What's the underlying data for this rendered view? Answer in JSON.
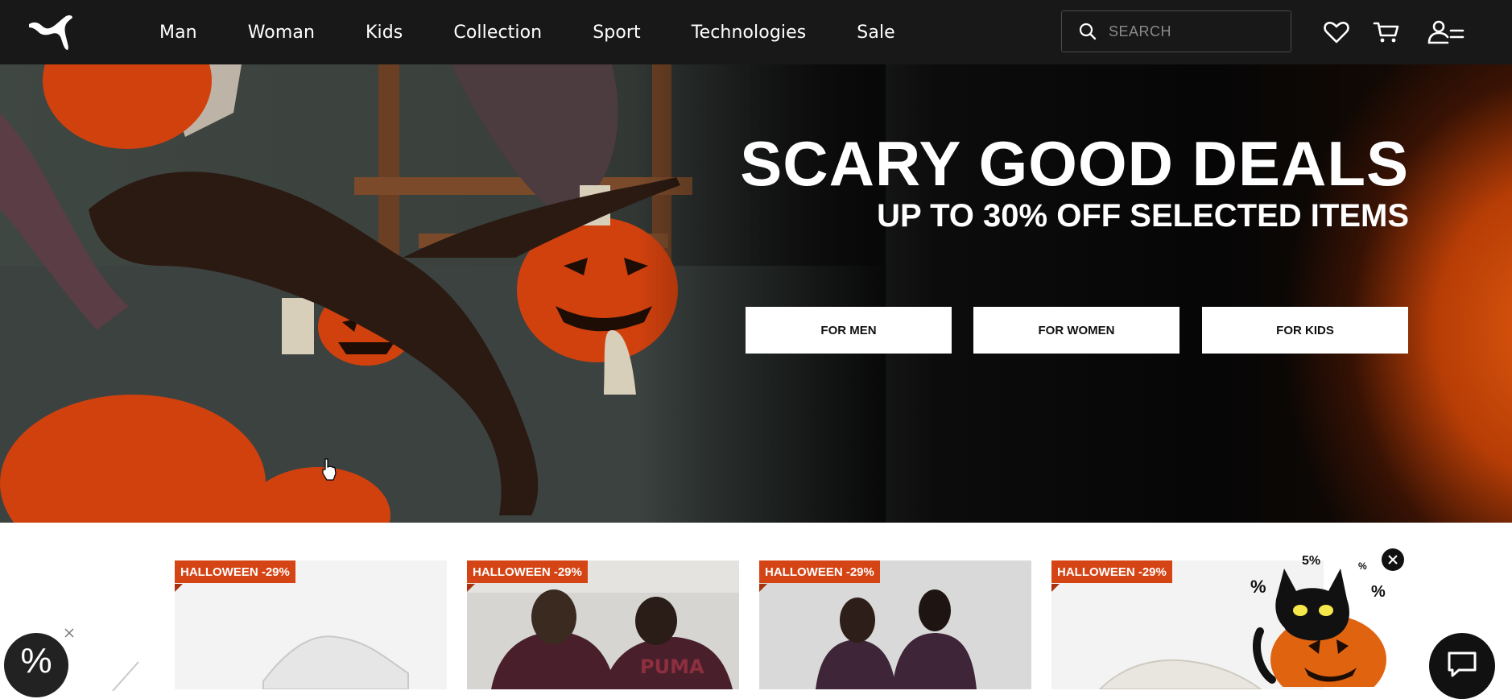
{
  "nav": {
    "items": [
      "Man",
      "Woman",
      "Kids",
      "Collection",
      "Sport",
      "Technologies",
      "Sale"
    ]
  },
  "search": {
    "placeholder": "SEARCH"
  },
  "header_icons": [
    "heart-icon",
    "cart-icon",
    "account-menu-icon"
  ],
  "hero": {
    "title": "SCARY GOOD DEALS",
    "subtitle": "UP TO 30% OFF SELECTED ITEMS",
    "buttons": [
      "FOR MEN",
      "FOR WOMEN",
      "FOR KIDS"
    ]
  },
  "products": [
    {
      "badge": "HALLOWEEN -29%"
    },
    {
      "badge": "HALLOWEEN -29%"
    },
    {
      "badge": "HALLOWEEN -29%"
    },
    {
      "badge": "HALLOWEEN -29%"
    }
  ],
  "promo_widget": {
    "label": "%"
  },
  "halloween_popup": {
    "labels": [
      "5%",
      "%",
      "%",
      "%"
    ]
  },
  "colors": {
    "header_bg": "#181818",
    "badge": "#d54414",
    "accent_orange": "#e0590e"
  }
}
